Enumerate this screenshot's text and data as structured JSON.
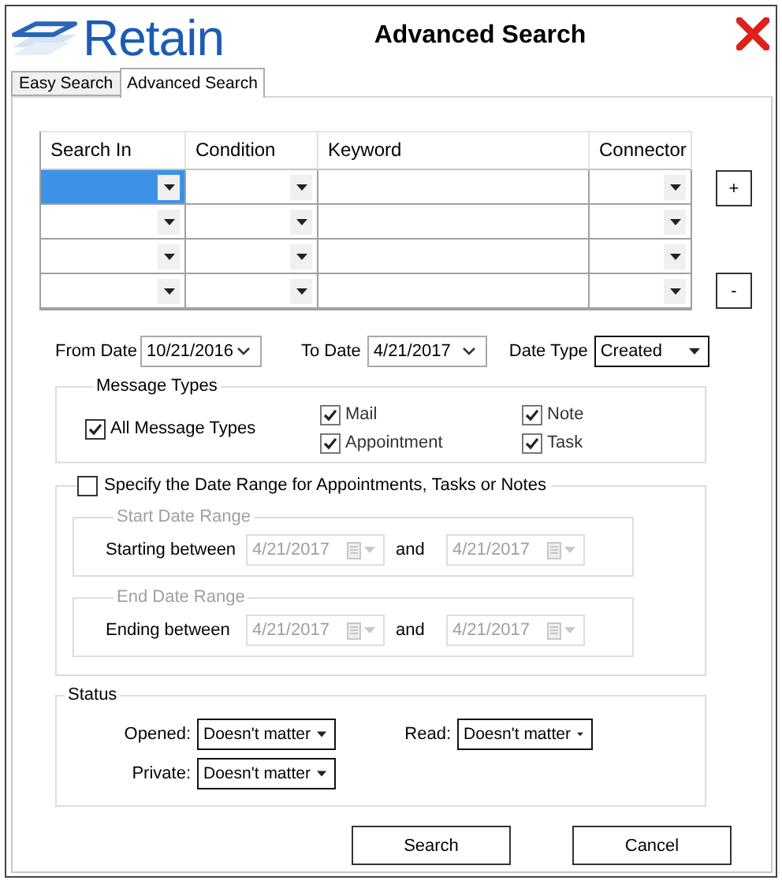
{
  "logo": {
    "text": "Retain"
  },
  "window": {
    "title": "Advanced Search"
  },
  "tabs": [
    {
      "label": "Easy Search",
      "selected": false
    },
    {
      "label": "Advanced Search",
      "selected": true
    }
  ],
  "criteria_grid": {
    "columns": [
      {
        "label": "Search In",
        "kind": "dropdown"
      },
      {
        "label": "Condition",
        "kind": "dropdown"
      },
      {
        "label": "Keyword",
        "kind": "text"
      },
      {
        "label": "Connector",
        "kind": "dropdown"
      }
    ],
    "rows": [
      {
        "cells": [
          {
            "selected": true
          },
          {
            "selected": false
          },
          {
            "selected": false
          },
          {
            "selected": false
          }
        ]
      },
      {
        "cells": [
          {
            "selected": false
          },
          {
            "selected": false
          },
          {
            "selected": false
          },
          {
            "selected": false
          }
        ]
      },
      {
        "cells": [
          {
            "selected": false
          },
          {
            "selected": false
          },
          {
            "selected": false
          },
          {
            "selected": false
          }
        ]
      },
      {
        "cells": [
          {
            "selected": false
          },
          {
            "selected": false
          },
          {
            "selected": false
          },
          {
            "selected": false
          }
        ]
      }
    ]
  },
  "row_buttons": [
    {
      "label": "+"
    },
    {
      "label": "-"
    }
  ],
  "dates": {
    "from_label": "From Date",
    "from_value": "10/21/2016",
    "to_label": "To Date",
    "to_value": "4/21/2017",
    "type_label": "Date Type",
    "type_value": "Created"
  },
  "message_types": {
    "title": "Message Types",
    "all": {
      "label": "All Message Types",
      "checked": true
    },
    "types": [
      {
        "label": "Mail",
        "checked": true
      },
      {
        "label": "Appointment",
        "checked": true
      },
      {
        "label": "Note",
        "checked": true
      },
      {
        "label": "Task",
        "checked": true
      }
    ]
  },
  "date_range": {
    "label": "Specify the Date Range for Appointments, Tasks or Notes",
    "checked": false,
    "groups": [
      {
        "title": "Start Date Range",
        "label": "Starting between",
        "from": "4/21/2017",
        "joiner": "and",
        "to": "4/21/2017"
      },
      {
        "title": "End Date Range",
        "label": "Ending between",
        "from": "4/21/2017",
        "joiner": "and",
        "to": "4/21/2017"
      }
    ]
  },
  "status": {
    "title": "Status",
    "fields": [
      {
        "label": "Opened:",
        "value": "Doesn't matter"
      },
      {
        "label": "Read:",
        "value": "Doesn't matter"
      },
      {
        "label": "Private:",
        "value": "Doesn't matter"
      }
    ]
  },
  "buttons": [
    {
      "label": "Search"
    },
    {
      "label": "Cancel"
    }
  ]
}
